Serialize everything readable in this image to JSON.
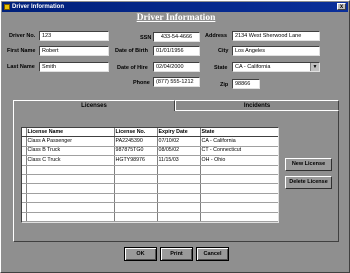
{
  "window": {
    "title": "Driver Information",
    "close_glyph": "x"
  },
  "form": {
    "heading": "Driver Information",
    "fields": {
      "driver_no": {
        "label": "Driver No.",
        "value": "123"
      },
      "first_name": {
        "label": "First Name",
        "value": "Robert"
      },
      "last_name": {
        "label": "Last Name",
        "value": "Smith"
      },
      "ssn": {
        "label": "SSN",
        "value": "433-54-4666"
      },
      "dob": {
        "label": "Date of Birth",
        "value": "01/01/1956"
      },
      "date_of_hire": {
        "label": "Date of Hire",
        "value": "02/04/2000"
      },
      "phone": {
        "label": "Phone",
        "value": "(877) 555-1212"
      },
      "address": {
        "label": "Address",
        "value": "2134 West Sherwood Lane"
      },
      "city": {
        "label": "City",
        "value": "Los Angeles"
      },
      "state": {
        "label": "State",
        "value": "CA - California",
        "arrow_glyph": "▼"
      },
      "zip": {
        "label": "Zip",
        "value": "98866"
      }
    }
  },
  "tabs": {
    "licenses": "Licenses",
    "incidents": "Incidents"
  },
  "licenses_grid": {
    "columns": [
      "License Name",
      "License No.",
      "Expiry Date",
      "State"
    ],
    "rows": [
      [
        "Class A Passenger",
        "PA2245390",
        "07/10/02",
        "CA - California"
      ],
      [
        "Class B Truck",
        "987875TG0",
        "08/05/02",
        "CT - Connecticut"
      ],
      [
        "Class C Truck",
        "HGTY98976",
        "11/15/03",
        "OH - Ohio"
      ],
      [
        "",
        "",
        "",
        ""
      ],
      [
        "",
        "",
        "",
        ""
      ],
      [
        "",
        "",
        "",
        ""
      ],
      [
        "",
        "",
        "",
        ""
      ],
      [
        "",
        "",
        "",
        ""
      ],
      [
        "",
        "",
        "",
        ""
      ],
      [
        "",
        "",
        "",
        ""
      ]
    ]
  },
  "buttons": {
    "new_license": "New License",
    "delete_license": "Delete License",
    "ok": "OK",
    "print": "Print",
    "cancel": "Cancel"
  }
}
